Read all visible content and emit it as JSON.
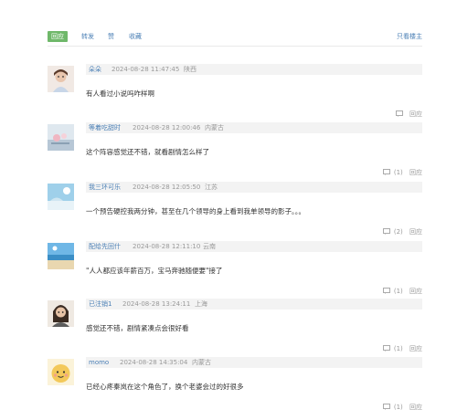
{
  "tabs": [
    {
      "label": "回应",
      "active": true
    },
    {
      "label": "转发",
      "active": false
    },
    {
      "label": "赞",
      "active": false
    },
    {
      "label": "收藏",
      "active": false
    }
  ],
  "only_host_label": "只看楼主",
  "colors": {
    "accent": "#6fb86a",
    "link": "#4a7fb5",
    "meta": "#999999",
    "header_bg": "#f3f3f3"
  },
  "comments": [
    {
      "user": "朵朵",
      "datetime": "2024-08-28 11:47:45",
      "location": "陕西",
      "text": "有人看过小说吗咋样啊",
      "count": "",
      "reply_label": "回应"
    },
    {
      "user": "等着吃甜时",
      "datetime": "2024-08-28 12:00:46",
      "location": "内蒙古",
      "text": "这个阵容感觉还不错，就看剧情怎么样了",
      "count": "(1)",
      "reply_label": "回应"
    },
    {
      "user": "我三环可乐",
      "datetime": "2024-08-28 12:05:50",
      "location": "江苏",
      "text": "一个预告硬控我两分钟，甚至在几个领导的身上看到我单领导的影子。。。",
      "count": "(2)",
      "reply_label": "回应"
    },
    {
      "user": "配给先回什",
      "datetime": "2024-08-28 12:11:10",
      "location": "云南",
      "text": "\"人人都应该年薪百万，宝马奔驰随便要\"接了",
      "count": "(1)",
      "reply_label": "回应"
    },
    {
      "user": "已注销1",
      "datetime": "2024-08-28 13:24:11",
      "location": "上海",
      "text": "感觉还不错，剧情紧凑点会很好看",
      "count": "(1)",
      "reply_label": "回应"
    },
    {
      "user": "momo",
      "datetime": "2024-08-28 14:35:04",
      "location": "内蒙古",
      "text": "已经心疼秦岚在这个角色了，换个老婆会过的好很多",
      "count": "(1)",
      "reply_label": "回应"
    }
  ]
}
